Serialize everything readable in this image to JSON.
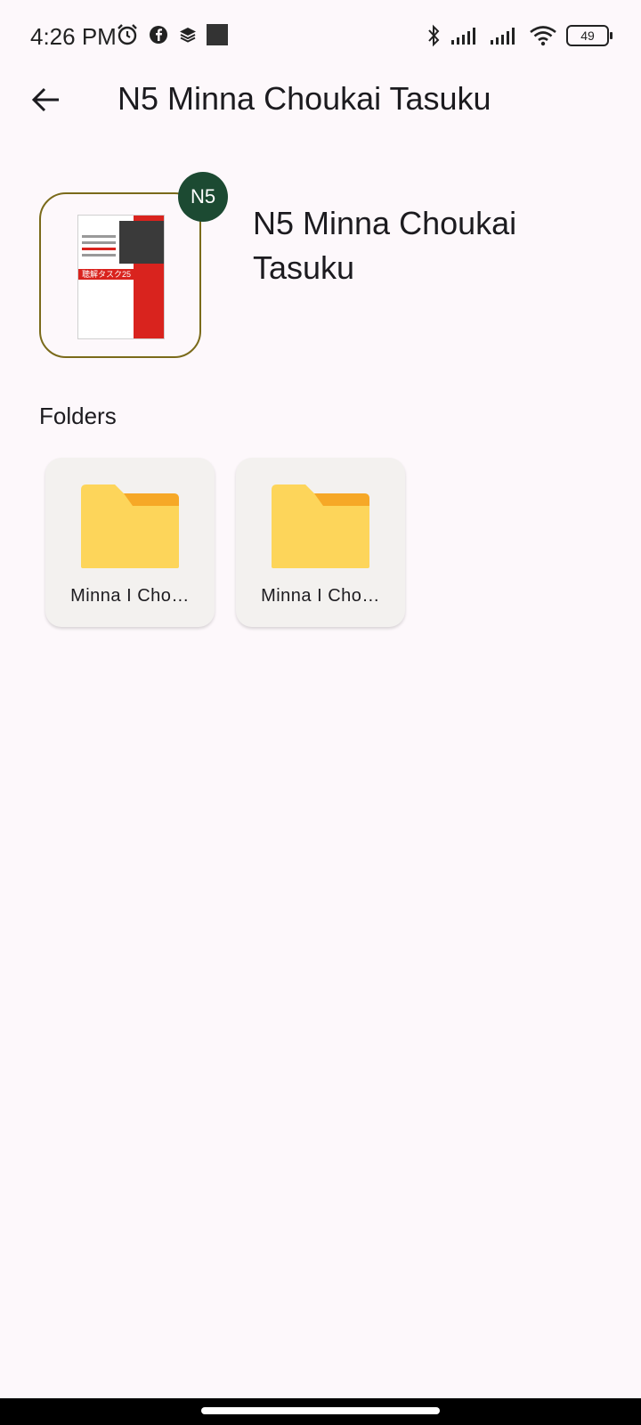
{
  "status_bar": {
    "time": "4:26 PM",
    "battery": "49",
    "icons": [
      "alarm-icon",
      "facebook-icon",
      "layers-icon",
      "square-icon",
      "bluetooth-icon",
      "signal-icon",
      "signal-icon",
      "wifi-icon",
      "battery-icon"
    ]
  },
  "app_bar": {
    "title": "N5 Minna Choukai Tasuku",
    "back_icon": "arrow-back-icon"
  },
  "header": {
    "badge": "N5",
    "name": "N5 Minna Choukai Tasuku",
    "cover_title_text": "聴解タスク25"
  },
  "folders_section": {
    "title": "Folders",
    "items": [
      {
        "label": "Minna I Cho…"
      },
      {
        "label": "Minna I Cho…"
      }
    ]
  },
  "colors": {
    "background": "#fdf8fb",
    "badge": "#1c4a32",
    "folder_body": "#fdd55a",
    "folder_tab": "#f6a827",
    "cover_border": "#7a6a1a"
  }
}
